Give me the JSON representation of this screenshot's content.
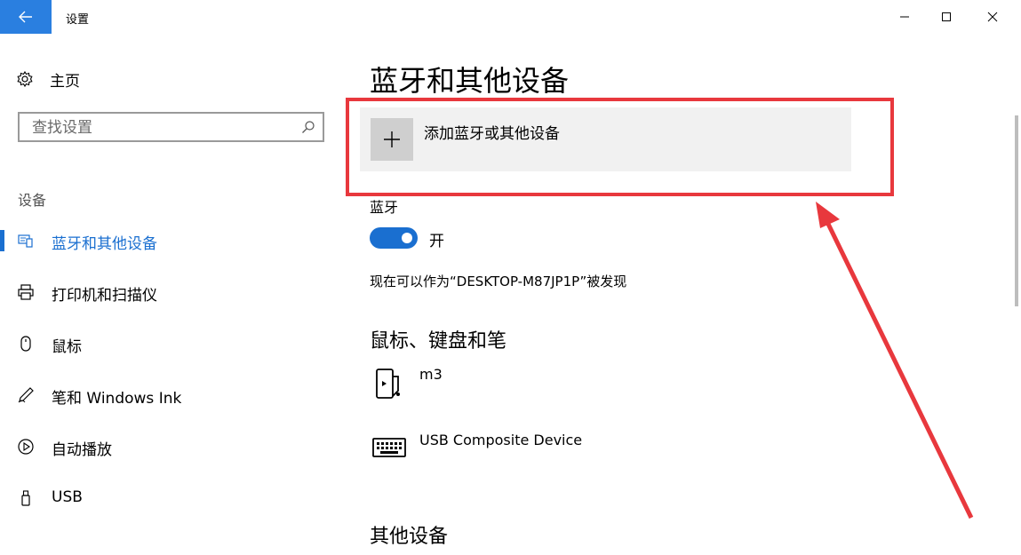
{
  "window": {
    "title": "设置"
  },
  "sidebar": {
    "home_label": "主页",
    "search_placeholder": "查找设置",
    "section_label": "设备",
    "items": [
      {
        "label": "蓝牙和其他设备",
        "icon": "bluetooth-devices-icon",
        "active": true
      },
      {
        "label": "打印机和扫描仪",
        "icon": "printer-icon",
        "active": false
      },
      {
        "label": "鼠标",
        "icon": "mouse-icon",
        "active": false
      },
      {
        "label": "笔和 Windows Ink",
        "icon": "pen-icon",
        "active": false
      },
      {
        "label": "自动播放",
        "icon": "autoplay-icon",
        "active": false
      },
      {
        "label": "USB",
        "icon": "usb-icon",
        "active": false
      }
    ]
  },
  "main": {
    "title": "蓝牙和其他设备",
    "add_device_label": "添加蓝牙或其他设备",
    "bluetooth_label": "蓝牙",
    "bluetooth_state": "开",
    "discoverable_text": "现在可以作为“DESKTOP-M87JP1P”被发现",
    "mouse_section": "鼠标、键盘和笔",
    "devices": [
      {
        "name": "m3",
        "icon": "phone-device-icon"
      },
      {
        "name": "USB Composite Device",
        "icon": "keyboard-icon"
      }
    ],
    "other_section": "其他设备"
  },
  "colors": {
    "accent": "#1a6fd0",
    "titlebar_back": "#2a7fe0",
    "highlight": "#e8383d"
  }
}
